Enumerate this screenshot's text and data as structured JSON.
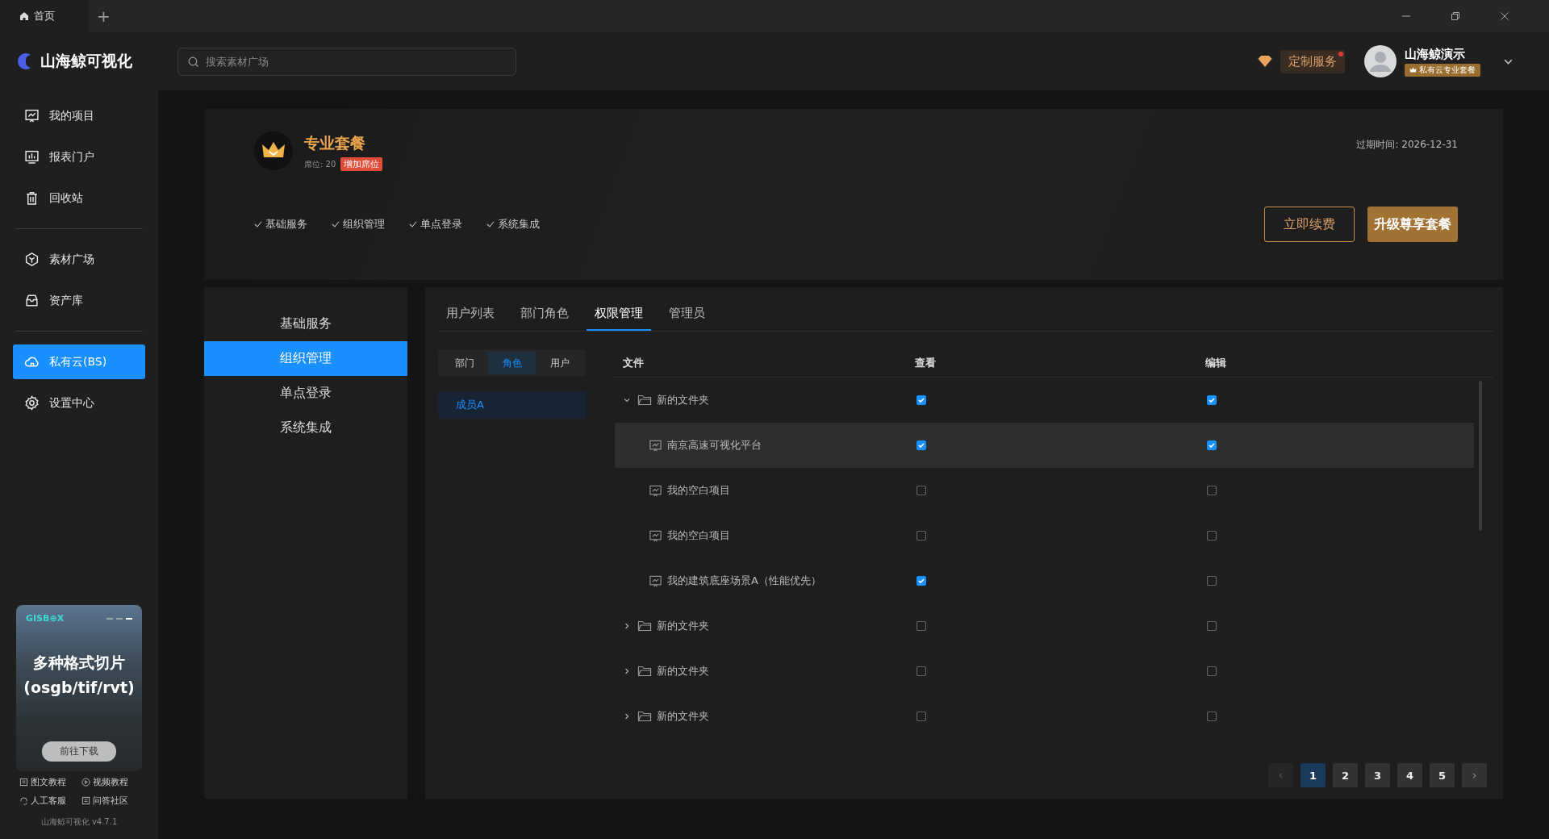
{
  "tabbar": {
    "tabs": [
      {
        "label": "首页",
        "selected": true
      }
    ],
    "add_tab": "+"
  },
  "logo_text": "山海鲸可视化",
  "search": {
    "placeholder": "搜索素材广场"
  },
  "header": {
    "service_badge": "定制服务",
    "notification": true,
    "user_name": "山海鲸演示",
    "plan_tag": "私有云专业套餐"
  },
  "sidebar": {
    "groups": [
      [
        {
          "label": "我的项目",
          "selected": false
        },
        {
          "label": "报表门户",
          "selected": false
        },
        {
          "label": "回收站",
          "selected": false
        }
      ],
      [
        {
          "label": "素材广场",
          "selected": false
        },
        {
          "label": "资产库",
          "selected": false
        }
      ],
      [
        {
          "label": "私有云(BS)",
          "selected": true
        },
        {
          "label": "设置中心",
          "selected": false
        }
      ]
    ]
  },
  "promo": {
    "brand": "GISB⊕X",
    "title": "多种格式切片",
    "subtitle": "(osgb/tif/rvt)",
    "button": "前往下载",
    "slides": [
      {
        "selected": false
      },
      {
        "selected": false
      },
      {
        "selected": true
      }
    ]
  },
  "help_links": [
    "图文教程",
    "视频教程",
    "人工客服",
    "问答社区"
  ],
  "version": "山海鲸可视化 v4.7.1",
  "plan": {
    "name": "专业套餐",
    "seats": "席位: 20",
    "add_seats": "增加席位",
    "features": [
      "基础服务",
      "组织管理",
      "单点登录",
      "系统集成"
    ],
    "expiry_label": "过期时间:",
    "expiry": "2026-12-31",
    "renew": "立即续费",
    "upgrade": "升级尊享套餐"
  },
  "menu": [
    {
      "label": "基础服务",
      "selected": false
    },
    {
      "label": "组织管理",
      "selected": true
    },
    {
      "label": "单点登录",
      "selected": false
    },
    {
      "label": "系统集成",
      "selected": false
    }
  ],
  "tabs": [
    {
      "label": "用户列表",
      "selected": false
    },
    {
      "label": "部门角色",
      "selected": false
    },
    {
      "label": "权限管理",
      "selected": true
    },
    {
      "label": "管理员",
      "selected": false
    }
  ],
  "filters": [
    {
      "label": "部门",
      "selected": false
    },
    {
      "label": "角色",
      "selected": true
    },
    {
      "label": "用户",
      "selected": false
    }
  ],
  "roles": [
    {
      "label": "成员A",
      "selected": true
    }
  ],
  "table": {
    "columns": [
      "文件",
      "查看",
      "编辑"
    ],
    "rows": [
      {
        "kind": "folder",
        "name": "新的文件夹",
        "expanded": true,
        "view": true,
        "edit": true,
        "selected": false,
        "children": [
          {
            "kind": "project",
            "name": "南京高速可视化平台",
            "view": true,
            "edit": true,
            "selected": true
          },
          {
            "kind": "project",
            "name": "我的空白项目",
            "view": false,
            "edit": false,
            "selected": false
          },
          {
            "kind": "project",
            "name": "我的空白项目",
            "view": false,
            "edit": false,
            "selected": false
          },
          {
            "kind": "project",
            "name": "我的建筑底座场景A（性能优先）",
            "view": true,
            "edit": false,
            "selected": false
          }
        ]
      },
      {
        "kind": "folder",
        "name": "新的文件夹",
        "expanded": false,
        "view": false,
        "edit": false,
        "selected": false
      },
      {
        "kind": "folder",
        "name": "新的文件夹",
        "expanded": false,
        "view": false,
        "edit": false,
        "selected": false
      },
      {
        "kind": "folder",
        "name": "新的文件夹",
        "expanded": false,
        "view": false,
        "edit": false,
        "selected": false
      }
    ]
  },
  "pagination": {
    "pages": [
      {
        "label": "1",
        "selected": true
      },
      {
        "label": "2",
        "selected": false
      },
      {
        "label": "3",
        "selected": false
      },
      {
        "label": "4",
        "selected": false
      },
      {
        "label": "5",
        "selected": false
      }
    ]
  }
}
